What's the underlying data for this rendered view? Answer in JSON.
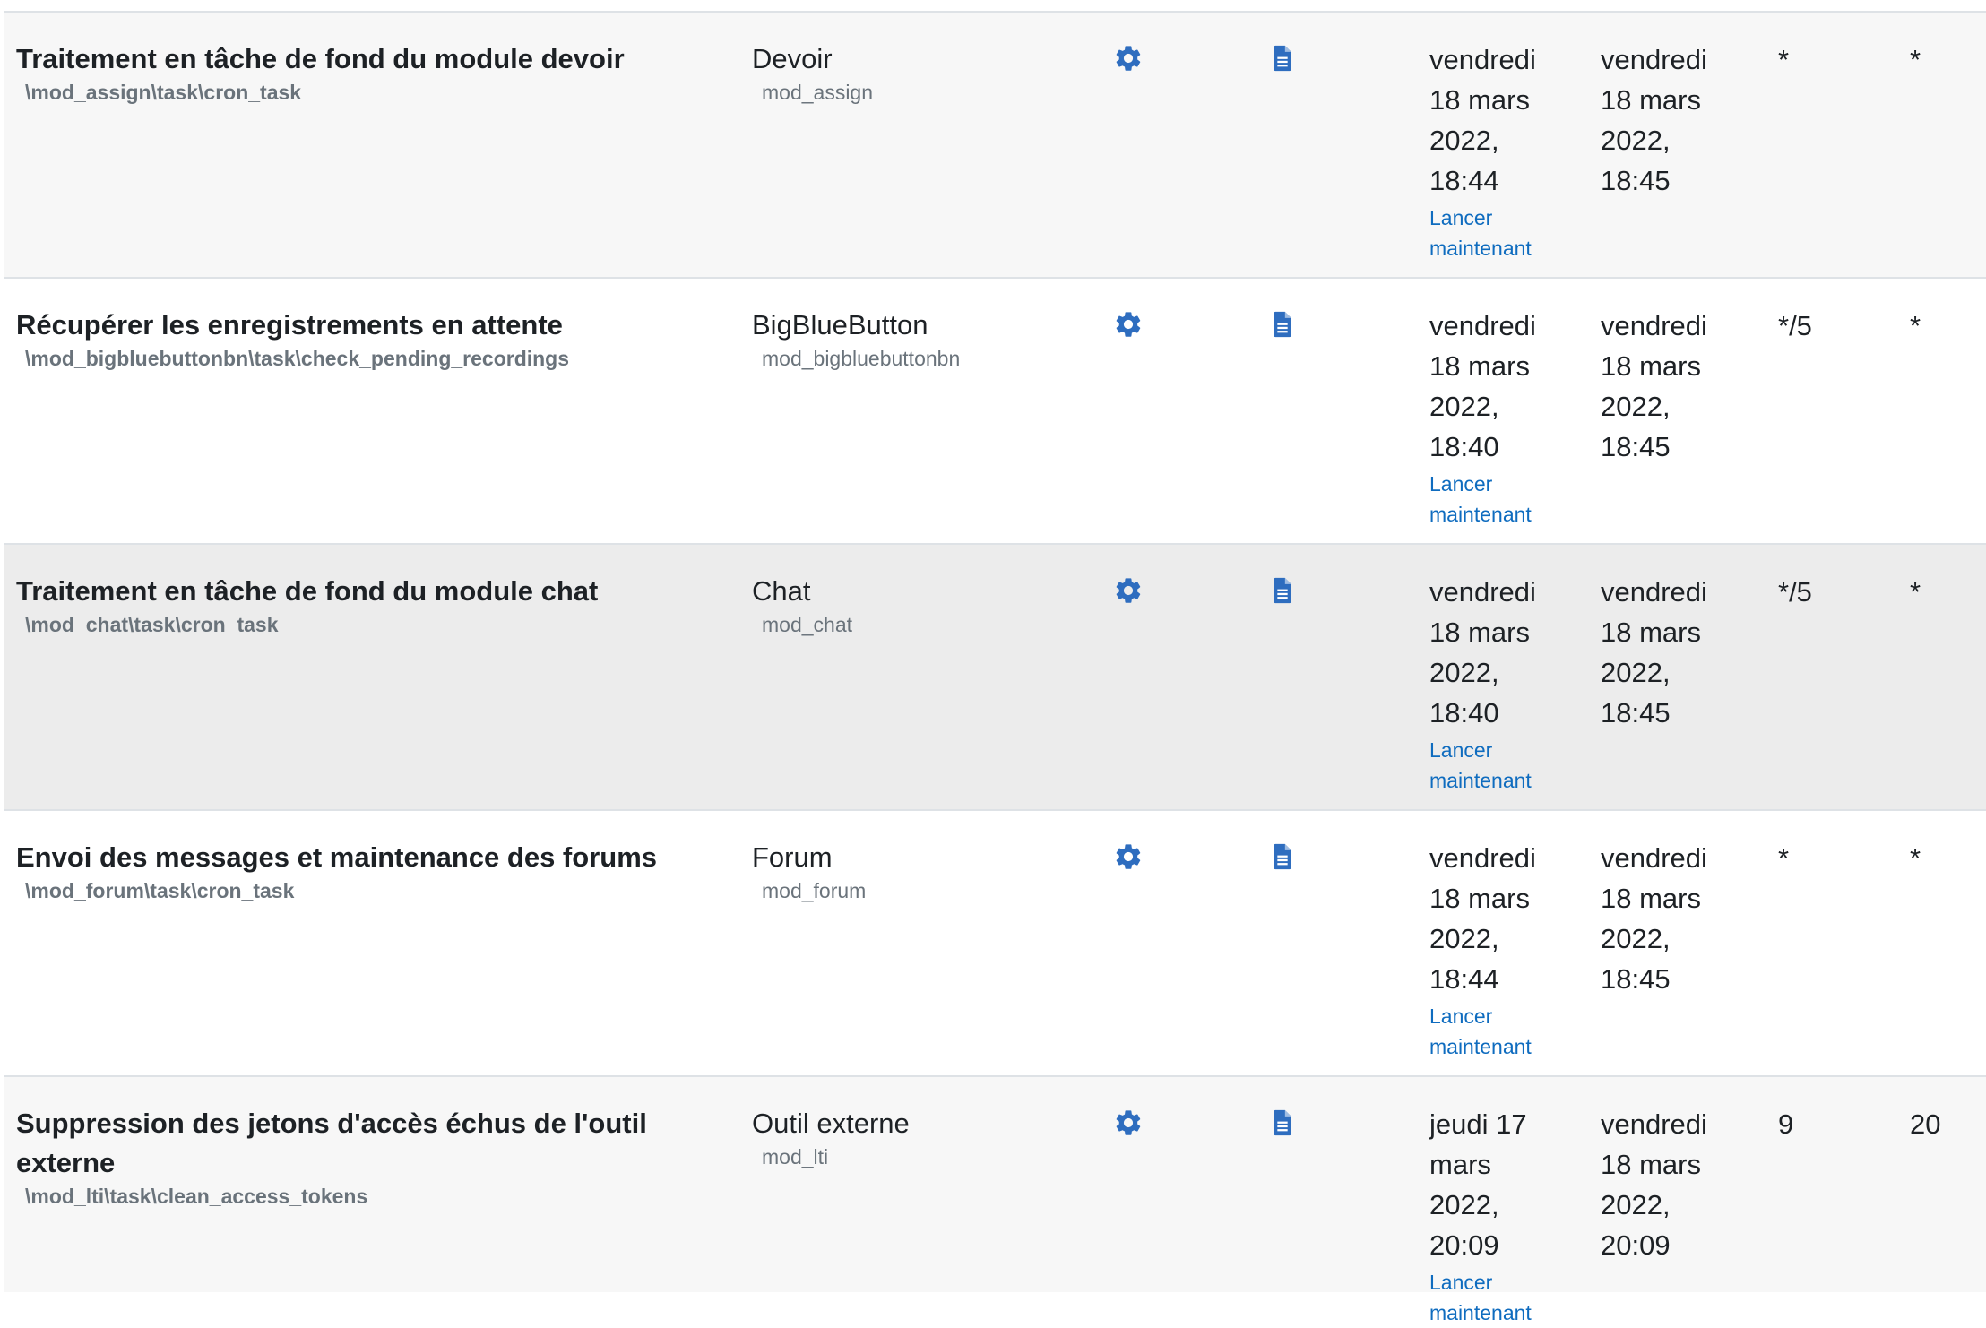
{
  "colors": {
    "accent": "#0f6cbf",
    "icon": "#2e6dbf",
    "muted_text": "#6a737b",
    "row_striped": "#f7f7f7",
    "row_hover": "#ececec",
    "border": "#dee2e6"
  },
  "icons": {
    "edit": "gear-icon",
    "log": "document-icon"
  },
  "rows": [
    {
      "name": "Traitement en tâche de fond du module devoir",
      "classname": "\\mod_assign\\task\\cron_task",
      "component": "Devoir",
      "component_code": "mod_assign",
      "last_run": "vendredi\n18 mars\n2022,\n18:44",
      "run_now": "Lancer\nmaintenant",
      "next_run": "vendredi\n18 mars\n2022,\n18:45",
      "minute": "*",
      "hour": "*"
    },
    {
      "name": "Récupérer les enregistrements en attente",
      "classname": "\\mod_bigbluebuttonbn\\task\\check_pending_recordings",
      "component": "BigBlueButton",
      "component_code": "mod_bigbluebuttonbn",
      "last_run": "vendredi\n18 mars\n2022,\n18:40",
      "run_now": "Lancer\nmaintenant",
      "next_run": "vendredi\n18 mars\n2022,\n18:45",
      "minute": "*/5",
      "hour": "*"
    },
    {
      "name": "Traitement en tâche de fond du module chat",
      "classname": "\\mod_chat\\task\\cron_task",
      "component": "Chat",
      "component_code": "mod_chat",
      "last_run": "vendredi\n18 mars\n2022,\n18:40",
      "run_now": "Lancer\nmaintenant",
      "next_run": "vendredi\n18 mars\n2022,\n18:45",
      "minute": "*/5",
      "hour": "*"
    },
    {
      "name": "Envoi des messages et maintenance des forums",
      "classname": "\\mod_forum\\task\\cron_task",
      "component": "Forum",
      "component_code": "mod_forum",
      "last_run": "vendredi\n18 mars\n2022,\n18:44",
      "run_now": "Lancer\nmaintenant",
      "next_run": "vendredi\n18 mars\n2022,\n18:45",
      "minute": "*",
      "hour": "*"
    },
    {
      "name": "Suppression des jetons d'accès échus de l'outil externe",
      "classname": "\\mod_lti\\task\\clean_access_tokens",
      "component": "Outil externe",
      "component_code": "mod_lti",
      "last_run": "jeudi 17\nmars\n2022,\n20:09",
      "run_now": "Lancer\nmaintenant",
      "next_run": "vendredi\n18 mars\n2022,\n20:09",
      "minute": "9",
      "hour": "20"
    }
  ]
}
